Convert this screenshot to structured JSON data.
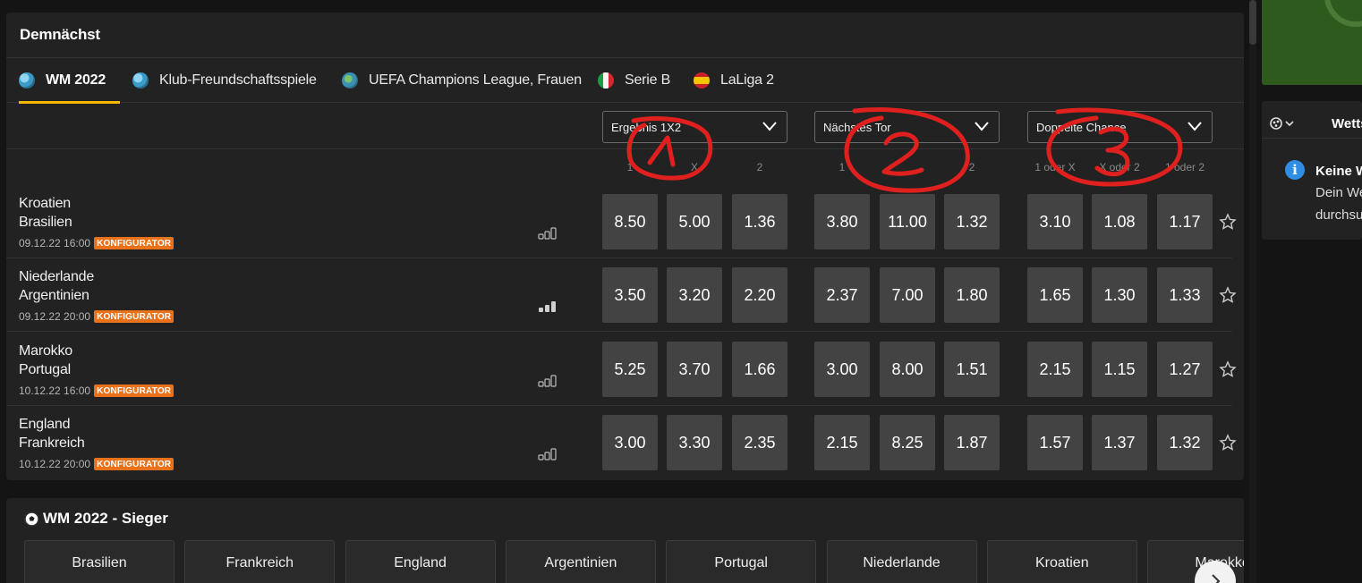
{
  "upcoming": {
    "title": "Demnächst",
    "tabs": [
      {
        "label": "WM 2022",
        "icon": "globe-icon",
        "active": true
      },
      {
        "label": "Klub-Freundschaftsspiele",
        "icon": "globe-icon"
      },
      {
        "label": "UEFA Champions League, Frauen",
        "icon": "globe-icon"
      },
      {
        "label": "Serie B",
        "icon": "italy-flag-icon"
      },
      {
        "label": "LaLiga 2",
        "icon": "spain-flag-icon"
      }
    ],
    "markets": [
      {
        "label": "Ergebnis 1X2",
        "columns": [
          "1",
          "X",
          "2"
        ]
      },
      {
        "label": "Nächstes Tor",
        "columns": [
          "1",
          "",
          "2"
        ]
      },
      {
        "label": "Doppelte Chance",
        "columns": [
          "1 oder X",
          "X oder 2",
          "1 oder 2"
        ]
      }
    ],
    "konfigurator_label": "KONFIGURATOR",
    "matches": [
      {
        "home": "Kroatien",
        "away": "Brasilien",
        "datetime": "09.12.22 16:00",
        "odds": [
          "8.50",
          "5.00",
          "1.36",
          "3.80",
          "11.00",
          "1.32",
          "3.10",
          "1.08",
          "1.17"
        ],
        "stats_active": false
      },
      {
        "home": "Niederlande",
        "away": "Argentinien",
        "datetime": "09.12.22 20:00",
        "odds": [
          "3.50",
          "3.20",
          "2.20",
          "2.37",
          "7.00",
          "1.80",
          "1.65",
          "1.30",
          "1.33"
        ],
        "stats_active": true
      },
      {
        "home": "Marokko",
        "away": "Portugal",
        "datetime": "10.12.22 16:00",
        "odds": [
          "5.25",
          "3.70",
          "1.66",
          "3.00",
          "8.00",
          "1.51",
          "2.15",
          "1.15",
          "1.27"
        ],
        "stats_active": false
      },
      {
        "home": "England",
        "away": "Frankreich",
        "datetime": "10.12.22 20:00",
        "odds": [
          "3.00",
          "3.30",
          "2.35",
          "2.15",
          "8.25",
          "1.87",
          "1.57",
          "1.37",
          "1.32"
        ],
        "stats_active": false
      }
    ]
  },
  "winner": {
    "title": "WM 2022 - Sieger",
    "teams": [
      "Brasilien",
      "Frankreich",
      "England",
      "Argentinien",
      "Portugal",
      "Niederlande",
      "Kroatien",
      "Marokko"
    ]
  },
  "sidebar": {
    "title": "Wetts",
    "info_bold": "Keine W",
    "info_line1": "Dein We",
    "info_line2": "durchsu"
  },
  "annotations": {
    "color": "#e0201e",
    "numbers": [
      "1",
      "2",
      "3"
    ]
  }
}
